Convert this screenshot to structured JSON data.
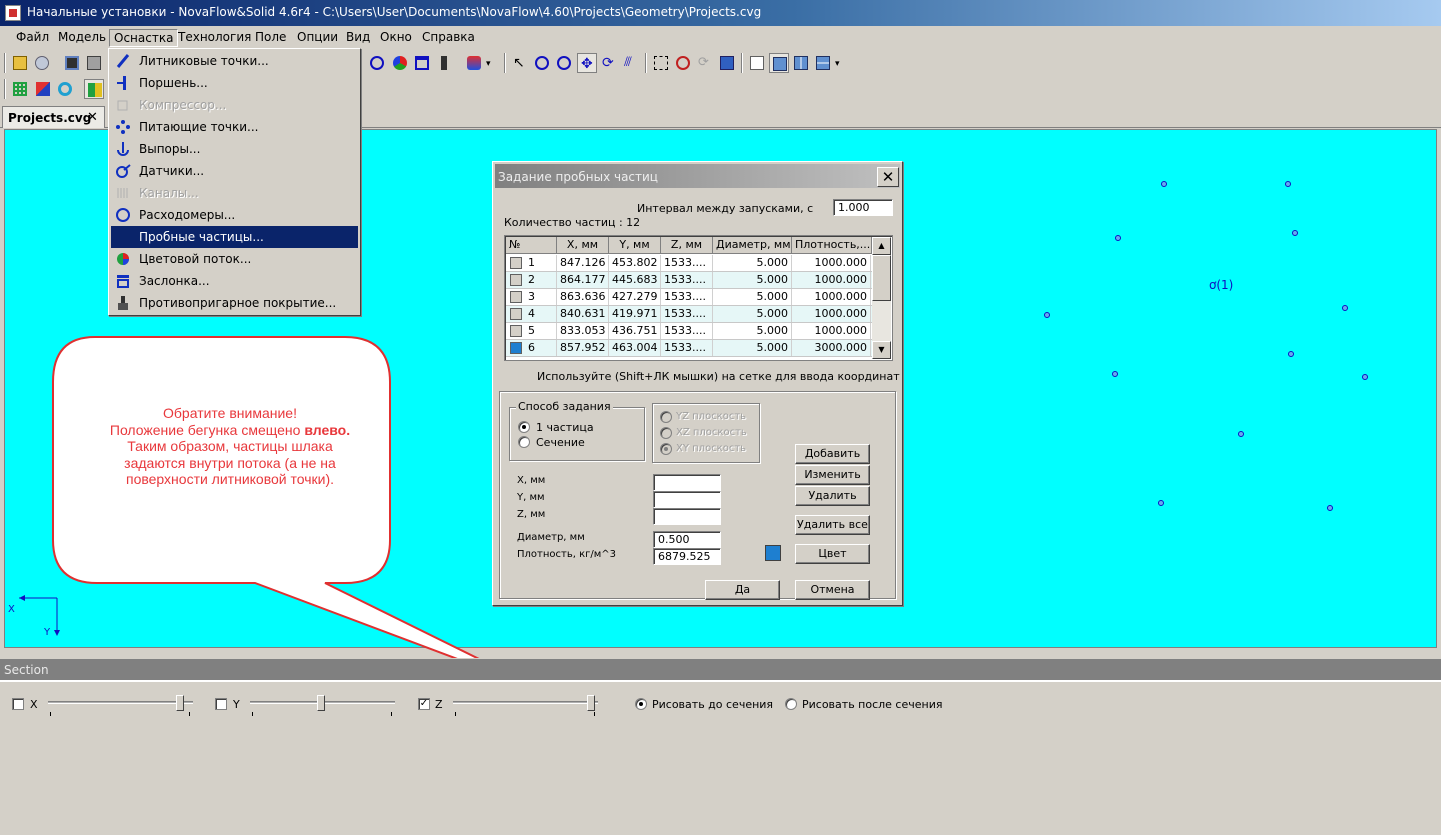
{
  "window": {
    "title": "Начальные установки - NovaFlow&Solid 4.6r4 - C:\\Users\\User\\Documents\\NovaFlow\\4.60\\Projects\\Geometry\\Projects.cvg"
  },
  "menubar": [
    "Файл",
    "Модель",
    "Оснастка",
    "Технология",
    "Поле",
    "Опции",
    "Вид",
    "Окно",
    "Справка"
  ],
  "tab": {
    "label": "Projects.cvg",
    "close": "✕"
  },
  "dropdown": [
    {
      "label": "Литниковые точки...",
      "icon": "gate-icon",
      "disabled": false
    },
    {
      "label": "Поршень...",
      "icon": "piston-icon",
      "disabled": false
    },
    {
      "label": "Компрессор...",
      "icon": "compressor-icon",
      "disabled": true
    },
    {
      "label": "Питающие точки...",
      "icon": "feeding-points-icon",
      "disabled": false
    },
    {
      "label": "Выпоры...",
      "icon": "vent-icon",
      "disabled": false
    },
    {
      "label": "Датчики...",
      "icon": "sensor-icon",
      "disabled": false
    },
    {
      "label": "Каналы...",
      "icon": "channels-icon",
      "disabled": true
    },
    {
      "label": "Расходомеры...",
      "icon": "flowmeter-icon",
      "disabled": false
    },
    {
      "label": "Пробные частицы...",
      "icon": "",
      "disabled": false,
      "selected": true
    },
    {
      "label": "Цветовой поток...",
      "icon": "color-flow-icon",
      "disabled": false
    },
    {
      "label": "Заслонка...",
      "icon": "shutter-icon",
      "disabled": false
    },
    {
      "label": "Противопригарное покрытие...",
      "icon": "coating-icon",
      "disabled": false
    }
  ],
  "canvas": {
    "sensor_label": "(1)",
    "axis_x": "X",
    "axis_y": "Y"
  },
  "callout": {
    "line1": "Обратите внимание!",
    "line2_prefix": "Положение бегунка смещено ",
    "line2_bold": "влево.",
    "line3": "Таким образом, частицы шлака",
    "line4": "задаются внутри потока (а не на",
    "line5": "поверхности литниковой точки)."
  },
  "dialog": {
    "title": "Задание пробных частиц",
    "count_label": "Количество частиц : 12",
    "interval_label": "Интервал между запусками, с",
    "interval_value": "1.000",
    "columns": [
      "№",
      "X, мм",
      "Y, мм",
      "Z, мм",
      "Диаметр, мм",
      "Плотность,..."
    ],
    "rows": [
      {
        "n": "1",
        "x": "847.126",
        "y": "453.802",
        "z": "1533....",
        "d": "5.000",
        "rho": "1000.000",
        "color": "#d4d0c8"
      },
      {
        "n": "2",
        "x": "864.177",
        "y": "445.683",
        "z": "1533....",
        "d": "5.000",
        "rho": "1000.000",
        "color": "#d4d0c8"
      },
      {
        "n": "3",
        "x": "863.636",
        "y": "427.279",
        "z": "1533....",
        "d": "5.000",
        "rho": "1000.000",
        "color": "#d4d0c8"
      },
      {
        "n": "4",
        "x": "840.631",
        "y": "419.971",
        "z": "1533....",
        "d": "5.000",
        "rho": "1000.000",
        "color": "#d4d0c8"
      },
      {
        "n": "5",
        "x": "833.053",
        "y": "436.751",
        "z": "1533....",
        "d": "5.000",
        "rho": "1000.000",
        "color": "#d4d0c8"
      },
      {
        "n": "6",
        "x": "857.952",
        "y": "463.004",
        "z": "1533....",
        "d": "5.000",
        "rho": "3000.000",
        "color": "#1e7fd0"
      }
    ],
    "hint": "Используйте (Shift+ЛК мышки) на сетке для ввода координат",
    "method_group": "Способ задания",
    "radio_one": "1 частица",
    "radio_section": "Сечение",
    "plane_yz": "YZ плоскость",
    "plane_xz": "XZ плоскость",
    "plane_xy": "XY плоскость",
    "x_label": "X, мм",
    "y_label": "Y, мм",
    "z_label": "Z, мм",
    "x_value": "",
    "y_value": "",
    "z_value": "",
    "diameter_label": "Диаметр, мм",
    "diameter_value": "0.500",
    "density_label": "Плотность, кг/м^3",
    "density_value": "6879.525",
    "btn_add": "Добавить",
    "btn_edit": "Изменить",
    "btn_delete": "Удалить",
    "btn_delete_all": "Удалить все",
    "btn_color": "Цвет",
    "btn_ok": "Да",
    "btn_cancel": "Отмена",
    "swatch_color": "#1e7fd0"
  },
  "section": {
    "title": "Section",
    "x_label": "X",
    "y_label": "Y",
    "z_label": "Z",
    "x_checked": false,
    "y_checked": false,
    "z_checked": true,
    "draw_before": "Рисовать до сечения",
    "draw_after": "Рисовать после сечения",
    "draw_before_selected": true
  },
  "colors": {
    "canvas": "#00ffff",
    "callout_text": "#e8383c",
    "callout_border": "#e03030",
    "highlight": "#0a246a"
  }
}
